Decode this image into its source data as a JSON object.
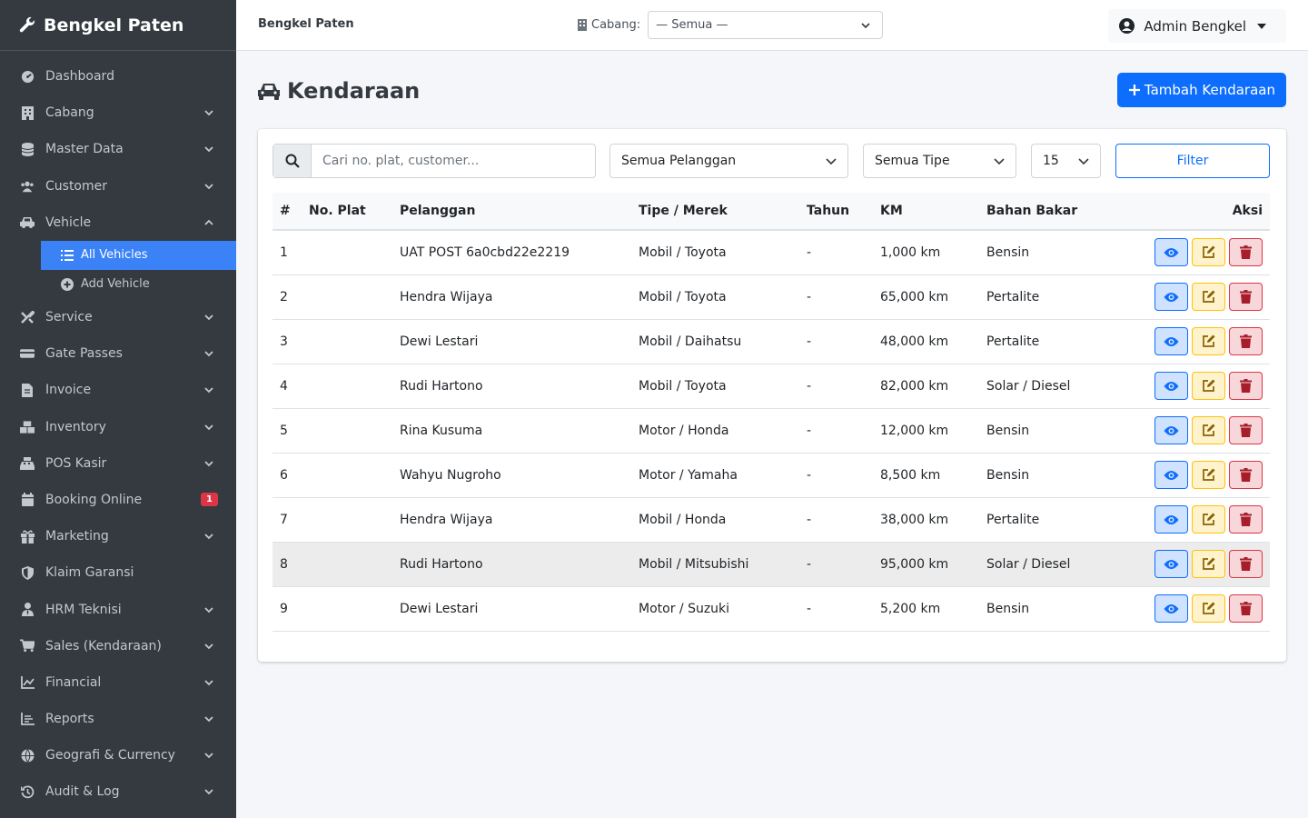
{
  "brand": {
    "name": "Bengkel Paten",
    "icon": "wrench-icon"
  },
  "sidebar": {
    "items": [
      {
        "label": "Dashboard",
        "icon": "dashboard-icon",
        "chevron": false
      },
      {
        "label": "Cabang",
        "icon": "building-icon",
        "chevron": true
      },
      {
        "label": "Master Data",
        "icon": "database-icon",
        "chevron": true
      },
      {
        "label": "Customer",
        "icon": "users-icon",
        "chevron": true
      },
      {
        "label": "Vehicle",
        "icon": "car-icon",
        "chevron": true,
        "expanded": true
      }
    ],
    "vehicle_sub": [
      {
        "label": "All Vehicles",
        "icon": "list-icon",
        "active": true
      },
      {
        "label": "Add Vehicle",
        "icon": "plus-circle-icon",
        "active": false
      }
    ],
    "items2": [
      {
        "label": "Service",
        "icon": "tools-icon"
      },
      {
        "label": "Gate Passes",
        "icon": "gate-icon"
      },
      {
        "label": "Invoice",
        "icon": "invoice-icon"
      },
      {
        "label": "Inventory",
        "icon": "boxes-icon"
      },
      {
        "label": "POS Kasir",
        "icon": "cash-register-icon"
      },
      {
        "label": "Booking Online",
        "icon": "calendar-icon",
        "badge": "1"
      },
      {
        "label": "Marketing",
        "icon": "gift-icon"
      },
      {
        "label": "Klaim Garansi",
        "icon": "shield-icon"
      },
      {
        "label": "HRM Teknisi",
        "icon": "user-tie-icon"
      },
      {
        "label": "Sales (Kendaraan)",
        "icon": "cart-icon"
      },
      {
        "label": "Financial",
        "icon": "chart-line-icon"
      },
      {
        "label": "Reports",
        "icon": "report-icon"
      },
      {
        "label": "Geografi & Currency",
        "icon": "globe-icon"
      },
      {
        "label": "Audit & Log",
        "icon": "history-icon"
      }
    ]
  },
  "topbar": {
    "title": "Bengkel Paten",
    "branch_label": "Cabang:",
    "branch_value": "— Semua —",
    "user": "Admin Bengkel"
  },
  "page": {
    "title": "Kendaraan",
    "add_button": "Tambah Kendaraan"
  },
  "filters": {
    "search_placeholder": "Cari no. plat, customer...",
    "customer": "Semua Pelanggan",
    "type": "Semua Tipe",
    "per_page": "15",
    "filter_button": "Filter"
  },
  "table": {
    "headers": [
      "#",
      "No. Plat",
      "Pelanggan",
      "Tipe / Merek",
      "Tahun",
      "KM",
      "Bahan Bakar",
      "Aksi"
    ],
    "rows": [
      {
        "no": "1",
        "plat": "",
        "pelanggan": "UAT POST 6a0cbd22e2219",
        "tipe": "Mobil / Toyota",
        "tahun": "-",
        "km": "1,000 km",
        "bbm": "Bensin"
      },
      {
        "no": "2",
        "plat": "",
        "pelanggan": "Hendra Wijaya",
        "tipe": "Mobil / Toyota",
        "tahun": "-",
        "km": "65,000 km",
        "bbm": "Pertalite"
      },
      {
        "no": "3",
        "plat": "",
        "pelanggan": "Dewi Lestari",
        "tipe": "Mobil / Daihatsu",
        "tahun": "-",
        "km": "48,000 km",
        "bbm": "Pertalite"
      },
      {
        "no": "4",
        "plat": "",
        "pelanggan": "Rudi Hartono",
        "tipe": "Mobil / Toyota",
        "tahun": "-",
        "km": "82,000 km",
        "bbm": "Solar / Diesel"
      },
      {
        "no": "5",
        "plat": "",
        "pelanggan": "Rina Kusuma",
        "tipe": "Motor / Honda",
        "tahun": "-",
        "km": "12,000 km",
        "bbm": "Bensin"
      },
      {
        "no": "6",
        "plat": "",
        "pelanggan": "Wahyu Nugroho",
        "tipe": "Motor / Yamaha",
        "tahun": "-",
        "km": "8,500 km",
        "bbm": "Bensin"
      },
      {
        "no": "7",
        "plat": "",
        "pelanggan": "Hendra Wijaya",
        "tipe": "Mobil / Honda",
        "tahun": "-",
        "km": "38,000 km",
        "bbm": "Pertalite"
      },
      {
        "no": "8",
        "plat": "",
        "pelanggan": "Rudi Hartono",
        "tipe": "Mobil / Mitsubishi",
        "tahun": "-",
        "km": "95,000 km",
        "bbm": "Solar / Diesel"
      },
      {
        "no": "9",
        "plat": "",
        "pelanggan": "Dewi Lestari",
        "tipe": "Motor / Suzuki",
        "tahun": "-",
        "km": "5,200 km",
        "bbm": "Bensin"
      }
    ]
  },
  "colors": {
    "sidebar_bg": "#343a40",
    "active_item": "#3b82f6",
    "primary": "#0d6efd",
    "warning": "#ffc107",
    "danger": "#dc3545"
  }
}
